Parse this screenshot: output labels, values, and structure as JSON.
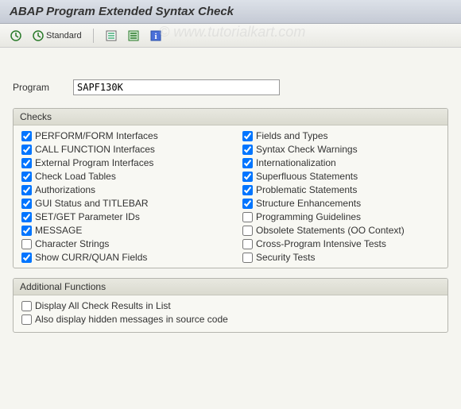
{
  "title": "ABAP Program Extended Syntax Check",
  "toolbar": {
    "standard_label": "Standard"
  },
  "program": {
    "label": "Program",
    "value": "SAPF130K"
  },
  "checks": {
    "header": "Checks",
    "left": [
      {
        "label": "PERFORM/FORM Interfaces",
        "checked": true
      },
      {
        "label": "CALL FUNCTION Interfaces",
        "checked": true
      },
      {
        "label": "External Program Interfaces",
        "checked": true
      },
      {
        "label": "Check Load Tables",
        "checked": true
      },
      {
        "label": "Authorizations",
        "checked": true
      },
      {
        "label": "GUI Status and TITLEBAR",
        "checked": true
      },
      {
        "label": "SET/GET Parameter IDs",
        "checked": true
      },
      {
        "label": "MESSAGE",
        "checked": true
      },
      {
        "label": "Character Strings",
        "checked": false
      },
      {
        "label": "Show CURR/QUAN Fields",
        "checked": true
      }
    ],
    "right": [
      {
        "label": "Fields and Types",
        "checked": true
      },
      {
        "label": "Syntax Check Warnings",
        "checked": true
      },
      {
        "label": "Internationalization",
        "checked": true
      },
      {
        "label": "Superfluous Statements",
        "checked": true
      },
      {
        "label": "Problematic Statements",
        "checked": true
      },
      {
        "label": "Structure Enhancements",
        "checked": true
      },
      {
        "label": "Programming Guidelines",
        "checked": false
      },
      {
        "label": "Obsolete Statements (OO Context)",
        "checked": false
      },
      {
        "label": "Cross-Program Intensive Tests",
        "checked": false
      },
      {
        "label": "Security Tests",
        "checked": false
      }
    ]
  },
  "additional": {
    "header": "Additional Functions",
    "items": [
      {
        "label": "Display All Check Results in List",
        "checked": false
      },
      {
        "label": "Also display hidden messages in source code",
        "checked": false
      }
    ]
  },
  "watermark": "© www.tutorialkart.com"
}
